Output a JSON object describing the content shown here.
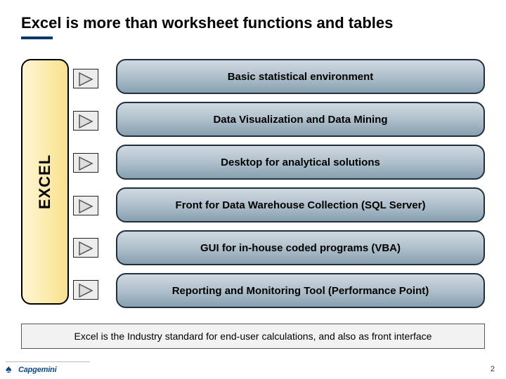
{
  "title": "Excel is more than worksheet functions and tables",
  "left_box_label": "EXCEL",
  "items": [
    "Basic statistical environment",
    "Data Visualization and Data Mining",
    "Desktop for analytical solutions",
    "Front for Data Warehouse Collection (SQL Server)",
    "GUI for in-house coded programs (VBA)",
    "Reporting and Monitoring Tool (Performance Point)"
  ],
  "footer": "Excel is the Industry standard for end-user calculations, and also as front interface",
  "page_number": "2",
  "logo": {
    "brand": "Capgemini",
    "tagline": ""
  }
}
